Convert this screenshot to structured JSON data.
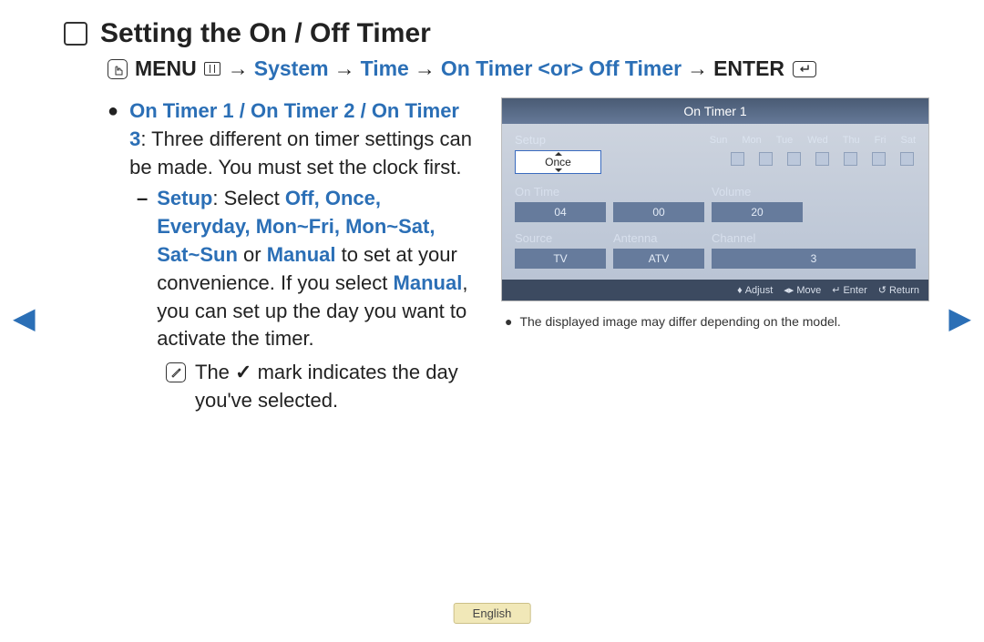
{
  "title": "Setting the On / Off Timer",
  "nav": {
    "menu_label": "MENU",
    "arrow": "→",
    "system": "System",
    "time": "Time",
    "on_timer": "On Timer",
    "or": "<or>",
    "off_timer": "Off Timer",
    "enter": "ENTER"
  },
  "body": {
    "heading": "On Timer 1 / On Timer 2 / On Timer 3",
    "heading_tail": ": Three different on timer settings can be made. You must set the clock first.",
    "setup_label": "Setup",
    "setup_text1": ": Select ",
    "setup_options": "Off, Once, Everyday, Mon~Fri, Mon~Sat, Sat~Sun",
    "setup_or": " or ",
    "setup_manual": "Manual",
    "setup_text2": " to set at your convenience. If you select ",
    "setup_manual2": "Manual",
    "setup_text3": ", you can set up the day you want to activate the timer.",
    "note_pre": "The ",
    "note_post": " mark indicates the day you've selected."
  },
  "osd": {
    "title": "On Timer 1",
    "setup_label": "Setup",
    "days": [
      "Sun",
      "Mon",
      "Tue",
      "Wed",
      "Thu",
      "Fri",
      "Sat"
    ],
    "once": "Once",
    "on_time_label": "On Time",
    "volume_label": "Volume",
    "hh": "04",
    "mm": "00",
    "volume": "20",
    "source_label": "Source",
    "antenna_label": "Antenna",
    "channel_label": "Channel",
    "source": "TV",
    "antenna": "ATV",
    "channel": "3",
    "footer_adjust": "Adjust",
    "footer_move": "Move",
    "footer_enter": "Enter",
    "footer_return": "Return"
  },
  "caption": "The displayed image may differ depending on the model.",
  "lang": "English"
}
